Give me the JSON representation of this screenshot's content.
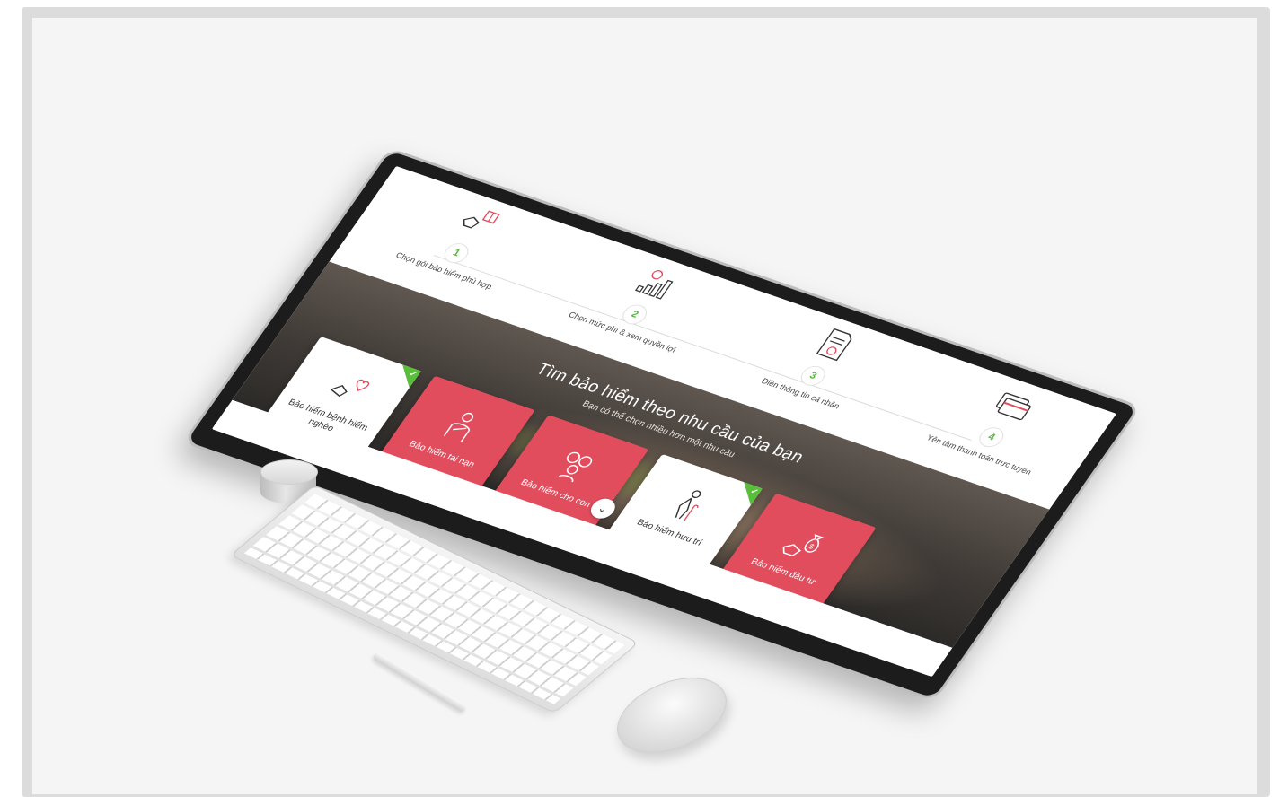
{
  "steps": [
    {
      "number": "1",
      "label": "Chọn gói bảo hiểm phù hợp",
      "icon": "handshake-gift-icon"
    },
    {
      "number": "2",
      "label": "Chọn mức phí & xem quyền lợi",
      "icon": "growth-chart-icon"
    },
    {
      "number": "3",
      "label": "Điền thông tin cá nhân",
      "icon": "document-person-icon"
    },
    {
      "number": "4",
      "label": "Yên tâm thanh toán trực tuyến",
      "icon": "credit-card-icon"
    }
  ],
  "hero": {
    "title": "Tìm bảo hiểm theo nhu cầu của bạn",
    "subtitle": "Bạn có thể chọn nhiều hơn một nhu cầu"
  },
  "cards": [
    {
      "label": "Bảo hiểm bệnh hiểm nghèo",
      "style": "white",
      "selected": true,
      "icon": "heart-hand-icon"
    },
    {
      "label": "Bảo hiểm tai nạn",
      "style": "red",
      "selected": false,
      "icon": "injured-person-icon"
    },
    {
      "label": "Bảo hiểm cho con",
      "style": "red",
      "selected": false,
      "icon": "family-icon"
    },
    {
      "label": "Bảo hiểm hưu trí",
      "style": "white",
      "selected": true,
      "icon": "elderly-person-icon"
    },
    {
      "label": "Bảo hiểm đầu tư",
      "style": "red",
      "selected": false,
      "icon": "money-bag-hand-icon"
    }
  ],
  "scroll_button": {
    "symbol": "⌄",
    "icon": "chevron-down-icon"
  },
  "colors": {
    "accent_red": "#e24d5e",
    "check_green": "#5bbd3c",
    "bezel": "#1c1c1c"
  }
}
